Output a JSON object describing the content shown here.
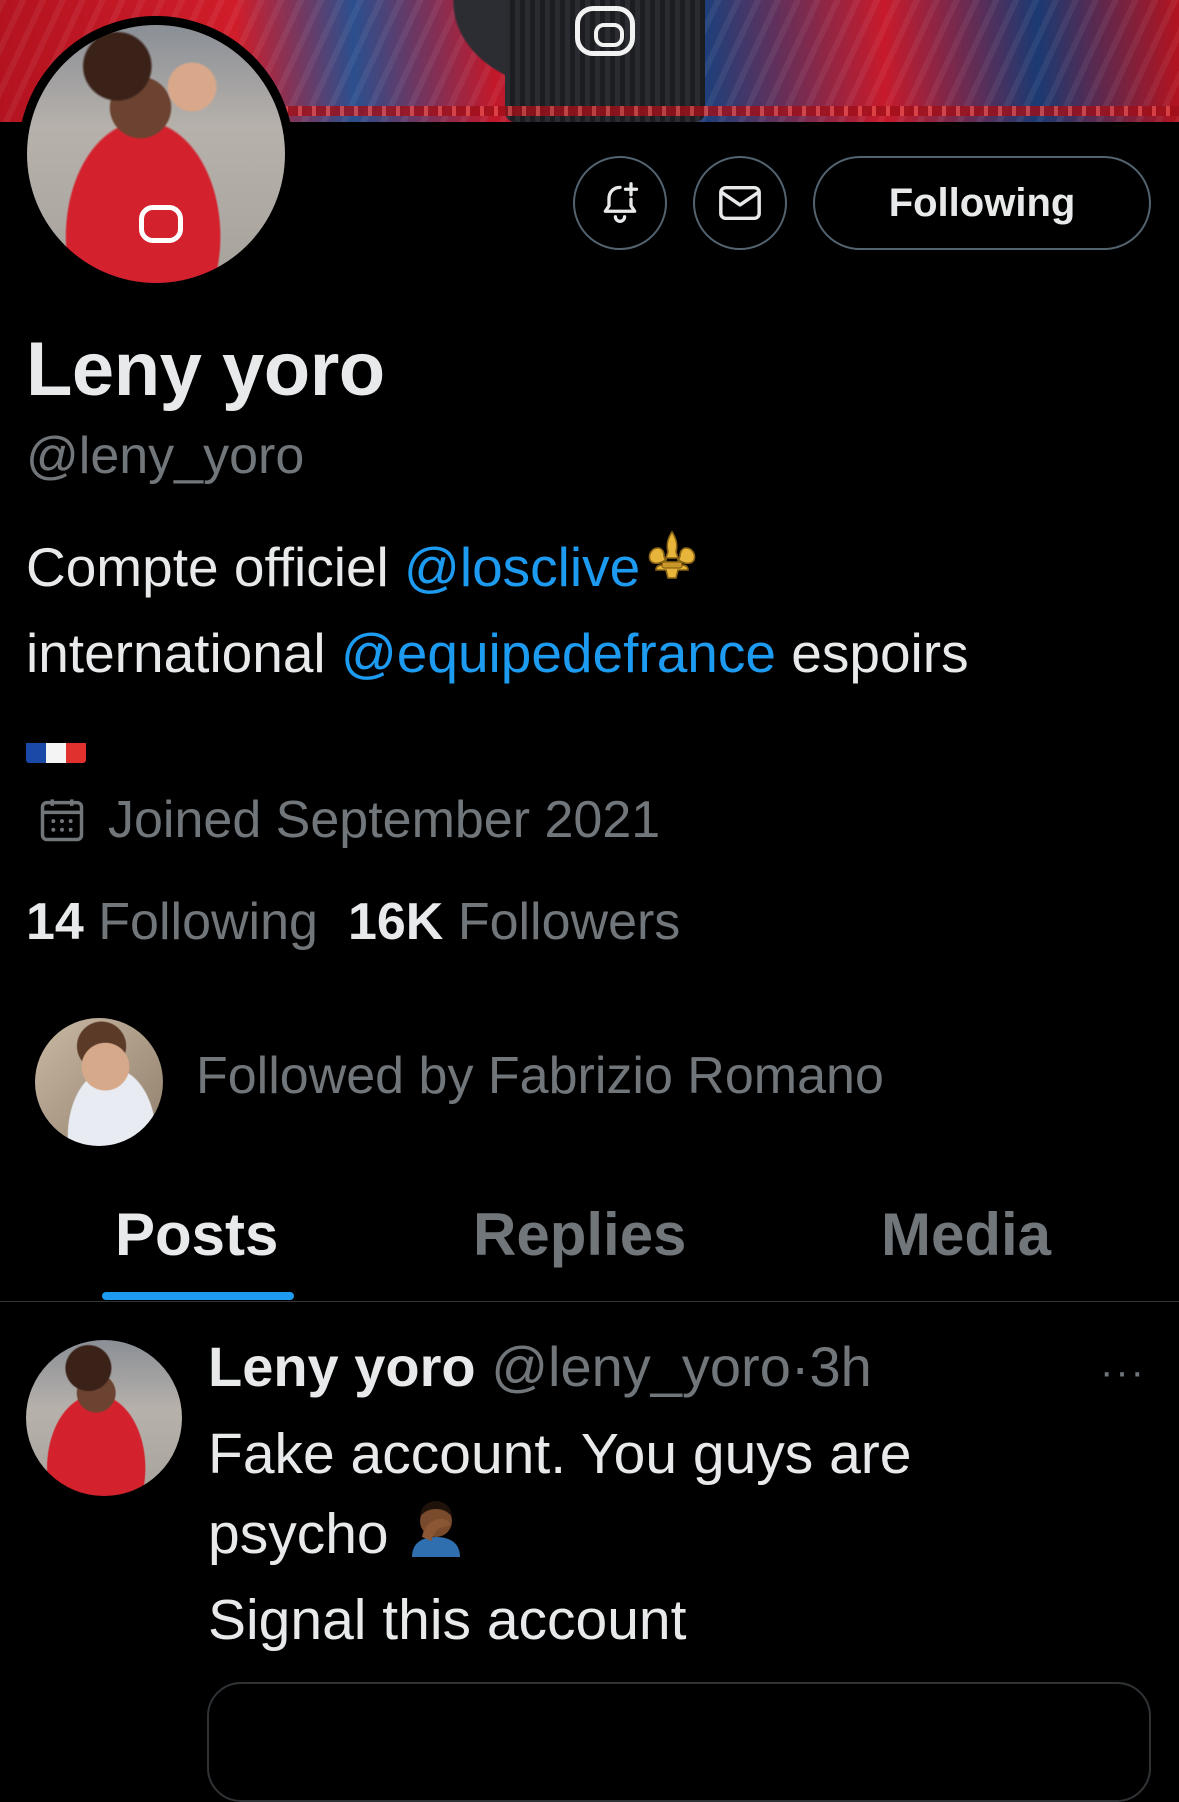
{
  "profile": {
    "name": "Leny yoro",
    "handle": "@leny_yoro",
    "bio": {
      "part1": "Compte officiel ",
      "mention1": "@losclive",
      "line2_prefix": "international ",
      "mention2": "@equipedefrance",
      "line2_suffix": " espoirs"
    },
    "joined": "Joined September 2021",
    "following_count": "14",
    "following_label": "Following",
    "followers_count": "16K",
    "followers_label": "Followers",
    "followed_by": "Followed by Fabrizio Romano"
  },
  "actions": {
    "notify_icon": "bell-plus-icon",
    "message_icon": "mail-icon",
    "follow_label": "Following"
  },
  "tabs": [
    {
      "label": "Posts",
      "active": true
    },
    {
      "label": "Replies",
      "active": false
    },
    {
      "label": "Media",
      "active": false
    }
  ],
  "post": {
    "name": "Leny yoro",
    "handle": "@leny_yoro",
    "separator": "·",
    "time": "3h",
    "line1": "Fake account. You guys are",
    "line2": "psycho ",
    "line3": "Signal this account",
    "more": "···"
  },
  "colors": {
    "background": "#000000",
    "text": "#e7e9ea",
    "muted": "#71767b",
    "link": "#1d9bf0",
    "border": "#536471"
  }
}
